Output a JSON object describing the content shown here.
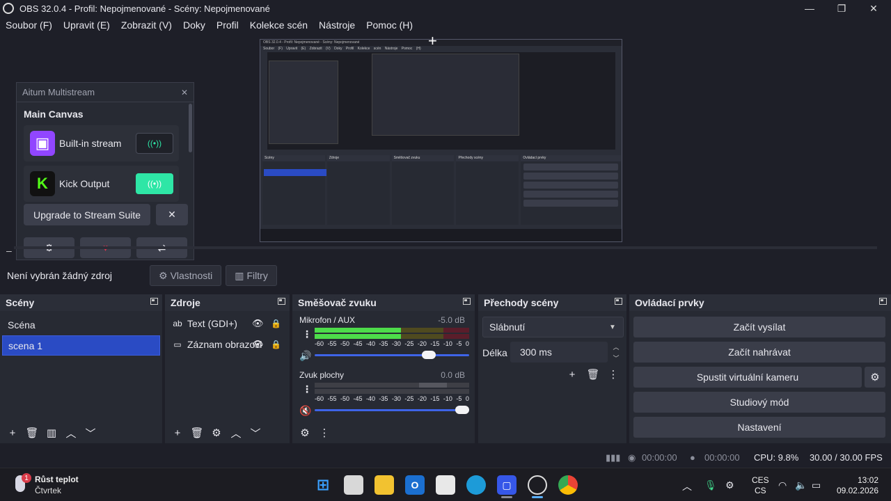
{
  "window": {
    "title": "OBS 32.0.4 - Profil: Nepojmenované - Scény: Nepojmenované",
    "minimize_icon": "minimize-icon",
    "maximize_icon": "restore-icon",
    "close_icon": "close-icon"
  },
  "menu": [
    "Soubor (F)",
    "Upravit (E)",
    "Zobrazit (V)",
    "Doky",
    "Profil",
    "Kolekce scén",
    "Nástroje",
    "Pomoc (H)"
  ],
  "preview": {
    "mini_title": "OBS 32.0.4 - Profil: Nepojmenované - Scény: Nepojmenované",
    "mini_menu": "Soubor (F)  Upravit (E)  Zobrazit (V)  Doky  Profil  Kolekce scén  Nástroje  Pomoc (H)"
  },
  "aitum": {
    "title": "Aitum Multistream",
    "heading": "Main Canvas",
    "outputs": [
      {
        "label": "Built-in stream",
        "color": "#9146ff",
        "active": false
      },
      {
        "label": "Kick Output",
        "color": "#53fc18",
        "active": true
      }
    ],
    "upgrade_label": "Upgrade to Stream Suite",
    "dismiss": "✕",
    "bottom_icons": [
      "gear-icon",
      "heart-icon",
      "switch-icon"
    ]
  },
  "source_toolbar": {
    "no_source": "Není vybrán žádný zdroj",
    "properties": "Vlastnosti",
    "filters": "Filtry"
  },
  "scenes": {
    "title": "Scény",
    "items": [
      {
        "name": "Scéna",
        "selected": false
      },
      {
        "name": "scena 1",
        "selected": true
      }
    ]
  },
  "sources": {
    "title": "Zdroje",
    "items": [
      {
        "name": "Text (GDI+)",
        "icon": "text-icon"
      },
      {
        "name": "Záznam obrazovky",
        "icon": "monitor-icon"
      }
    ]
  },
  "mixer": {
    "title": "Směšovač zvuku",
    "scale": [
      "-60",
      "-55",
      "-50",
      "-45",
      "-40",
      "-35",
      "-30",
      "-25",
      "-20",
      "-15",
      "-10",
      "-5",
      "0"
    ],
    "channels": [
      {
        "name": "Mikrofon / AUX",
        "db": "-5.0 dB",
        "level": 0.75,
        "volume": 0.76,
        "muted": false
      },
      {
        "name": "Zvuk plochy",
        "db": "0.0 dB",
        "level": 0.0,
        "volume": 1.0,
        "muted": true
      }
    ]
  },
  "transitions": {
    "title": "Přechody scény",
    "selected": "Slábnutí",
    "duration_label": "Délka",
    "duration_value": "300 ms"
  },
  "controls": {
    "title": "Ovládací prvky",
    "buttons": [
      "Začít vysílat",
      "Začít nahrávat",
      "Spustit virtuální kameru",
      "Studiový mód",
      "Nastavení"
    ]
  },
  "status": {
    "stream_time": "00:00:00",
    "record_time": "00:00:00",
    "cpu": "CPU: 9.8%",
    "fps": "30.00 / 30.00 FPS"
  },
  "taskbar": {
    "weather_badge": "1",
    "weather_title": "Růst teplot",
    "weather_sub": "Čtvrtek",
    "lang_top": "CES",
    "lang_bottom": "CS",
    "time": "13:02",
    "date": "09.02.2026"
  }
}
